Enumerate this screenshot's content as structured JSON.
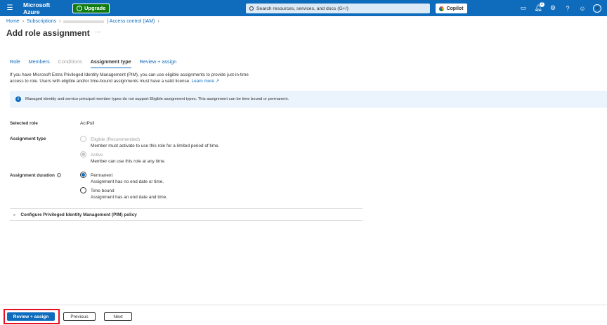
{
  "topbar": {
    "brand": "Microsoft Azure",
    "upgrade_label": "Upgrade",
    "search_placeholder": "Search resources, services, and docs (G+/)",
    "copilot_label": "Copilot",
    "notification_count": "2"
  },
  "breadcrumb": {
    "items": [
      "Home",
      "Subscriptions",
      "| Access control (IAM)"
    ]
  },
  "page": {
    "title": "Add role assignment",
    "more": "···"
  },
  "tabs": [
    {
      "label": "Role",
      "state": "link"
    },
    {
      "label": "Members",
      "state": "link"
    },
    {
      "label": "Conditions",
      "state": "disabled"
    },
    {
      "label": "Assignment type",
      "state": "active"
    },
    {
      "label": "Review + assign",
      "state": "link"
    }
  ],
  "intro": {
    "text": "If you have Microsoft Entra Privileged Identity Management (PIM), you can use eligible assignments to provide just-in-time access to role. Users with eligible and/or time-bound assignments must have a valid license.",
    "link": "Learn more"
  },
  "info_bar": {
    "text": "Managed identity and service principal member types do not support Eligible assignment types. This assignment can be time bound or permanent."
  },
  "form": {
    "selected_role_label": "Selected role",
    "selected_role_value": "AcrPull",
    "assignment_type_label": "Assignment type",
    "assignment_type_options": [
      {
        "title": "Eligible (Recommended)",
        "desc": "Member must activate to use this role for a limited period of time.",
        "selected": false,
        "disabled": true
      },
      {
        "title": "Active",
        "desc": "Member can use this role at any time.",
        "selected": true,
        "disabled": true
      }
    ],
    "duration_label": "Assignment duration",
    "duration_options": [
      {
        "title": "Permanent",
        "desc": "Assignment has no end date or time.",
        "selected": true
      },
      {
        "title": "Time bound",
        "desc": "Assignment has an end date and time.",
        "selected": false
      }
    ],
    "pim_section": "Configure Privileged Identity Management (PIM) policy"
  },
  "footer": {
    "review_assign": "Review + assign",
    "previous": "Previous",
    "next": "Next"
  },
  "colors": {
    "accent": "#0f6cbd",
    "highlight": "#e81123"
  }
}
